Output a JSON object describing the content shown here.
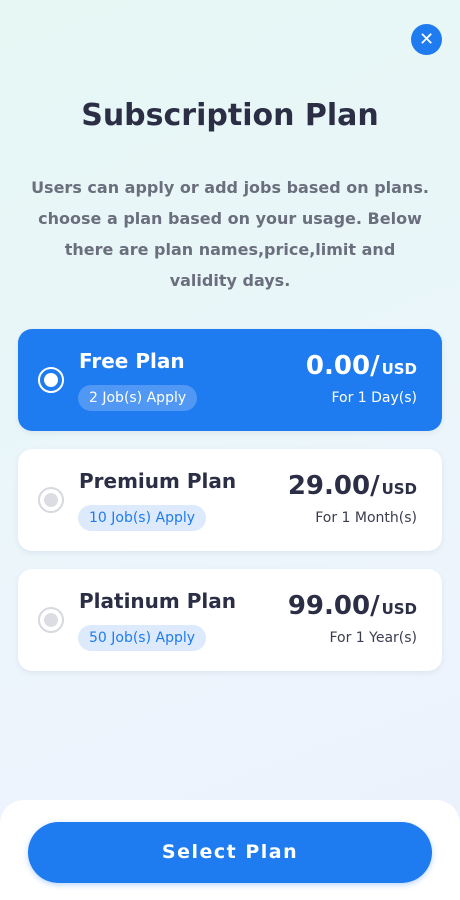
{
  "header": {
    "close_icon": "close-icon",
    "close_glyph": "✕",
    "title": "Subscription Plan",
    "description": "Users can apply or add jobs based on plans. choose a plan based on your usage. Below there are plan names,price,limit and validity days."
  },
  "plans": [
    {
      "name": "Free Plan",
      "badge": "2 Job(s) Apply",
      "price": "0.00",
      "slash": "/",
      "currency": "USD",
      "validity": "For 1 Day(s)",
      "selected": true
    },
    {
      "name": "Premium Plan",
      "badge": "10 Job(s) Apply",
      "price": "29.00",
      "slash": "/",
      "currency": "USD",
      "validity": "For 1 Month(s)",
      "selected": false
    },
    {
      "name": "Platinum Plan",
      "badge": "50 Job(s) Apply",
      "price": "99.00",
      "slash": "/",
      "currency": "USD",
      "validity": "For 1 Year(s)",
      "selected": false
    }
  ],
  "footer": {
    "select_label": "Select Plan"
  },
  "colors": {
    "accent": "#1f7bf0",
    "title": "#2b2e45",
    "badge_bg": "#ddeafc"
  }
}
